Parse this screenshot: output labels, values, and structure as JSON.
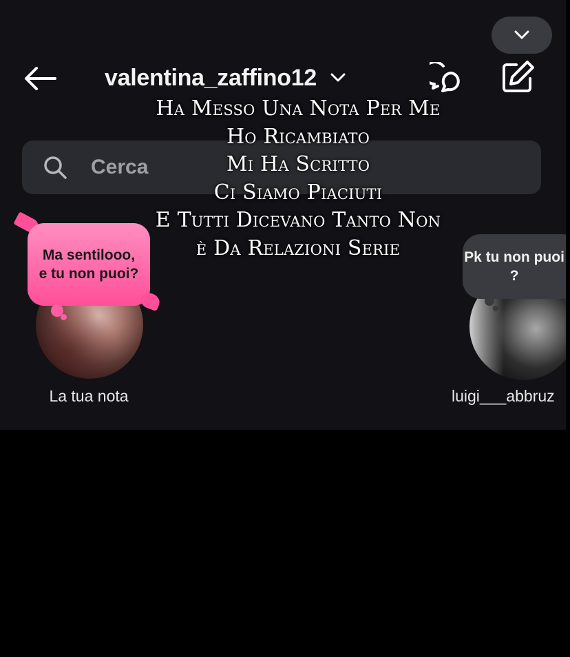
{
  "header": {
    "username": "valentina_zaffino12"
  },
  "search": {
    "placeholder": "Cerca"
  },
  "overlay_caption": [
    "Ha Messo Una Nota Per Me",
    "Ho Ricambiato",
    "Mi Ha Scritto",
    "Ci Siamo Piaciuti",
    "E Tutti Dicevano Tanto Non",
    "è Da Relazioni Serie"
  ],
  "notes": [
    {
      "text": "Ma sentilooo, e tu non puoi?",
      "label": "La tua nota"
    },
    {
      "text": "Pk tu non puoi ?",
      "label": "luigi___abbruz"
    }
  ],
  "icons": {
    "collapse": "chevron-down-icon",
    "back": "arrow-left-icon",
    "username_dropdown": "chevron-down-icon",
    "threads": "threads-icon",
    "compose": "compose-icon",
    "search": "search-icon"
  },
  "colors": {
    "background": "#111116",
    "note_pink": "#ff5ea3",
    "note_gray": "#3a3b40",
    "search_bg": "#2a2b30"
  }
}
